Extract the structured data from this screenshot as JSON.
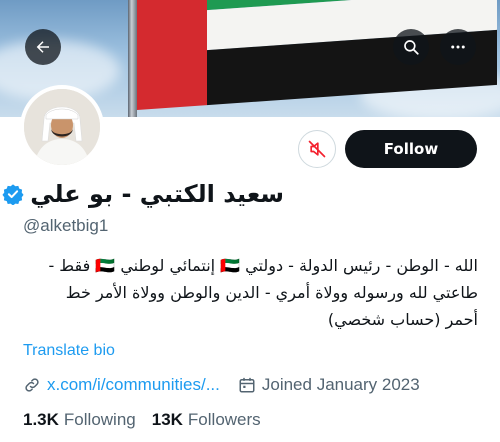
{
  "header": {
    "back_icon": "arrow-left-icon",
    "search_icon": "search-icon",
    "more_icon": "more-horizontal-icon"
  },
  "profile": {
    "display_name": "سعيد الكتبي - بو علي",
    "verified": true,
    "handle": "@alketbig1",
    "bio_lines": [
      "الله - الوطن - رئيس الدولة - دولتي 🇦🇪 إنتمائي لوطني 🇦🇪 فقط -",
      "طاعتي لله ورسوله وولاة أمري - الدين والوطن وولاة الأمر خط",
      "أحمر (حساب شخصي)"
    ],
    "translate_label": "Translate bio",
    "link_text": "x.com/i/communities/...",
    "joined_text": "Joined January 2023",
    "following_count": "1.3K",
    "following_label": "Following",
    "followers_count": "13K",
    "followers_label": "Followers"
  },
  "actions": {
    "follow_label": "Follow",
    "mute_icon": "bell-off-icon"
  },
  "colors": {
    "accent": "#1d9bf0",
    "mute_red": "#f4212e",
    "follow_bg": "#0f1419",
    "secondary_text": "#536471"
  }
}
